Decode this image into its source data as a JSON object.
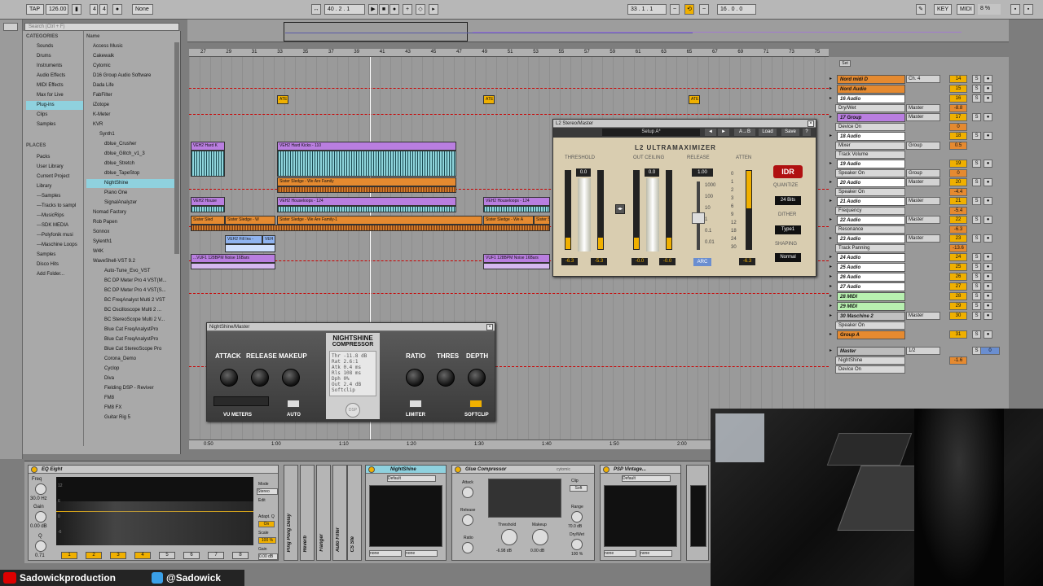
{
  "transport": {
    "tap": "TAP",
    "tempo": "126.00",
    "signature_num": "4",
    "signature_den": "4",
    "quant": "None",
    "position": "40 . 2 . 1",
    "loop_start": "33 . 1 . 1",
    "loop_len": "16 . 0 . 0",
    "key": "KEY",
    "midi": "MIDI",
    "cpu": "8 %"
  },
  "browser": {
    "categories_header": "CATEGORIES",
    "search_placeholder": "Search (Ctrl + F)",
    "categories": [
      "Sounds",
      "Drums",
      "Instruments",
      "Audio Effects",
      "MIDI Effects",
      "Max for Live",
      "Plug-ins",
      "Clips",
      "Samples"
    ],
    "places_header": "PLACES",
    "places": [
      "Packs",
      "User Library",
      "Current Project",
      "Library",
      "---Samples",
      "---Tracks to sampl",
      "---MusicRips",
      "---SDK MEDIA",
      "---Polyfonik musi",
      "---Maschine Loops",
      "Samples",
      "Disco Hits",
      "Add Folder..."
    ],
    "name_header": "Name",
    "items": [
      "Access Music",
      "Cakewalk",
      "Cytomic",
      "D16 Group Audio Software",
      "Dada Life",
      "FabFilter",
      "iZotope",
      "K-Meter",
      "KVR",
      "Synth1",
      "dblue_Crusher",
      "dblue_Glitch_v1_3",
      "dblue_Stretch",
      "dblue_TapeStop",
      "NightShine",
      "Piano One",
      "SignalAnalyzer",
      "Nomad Factory",
      "Rob Papen",
      "Sonnox",
      "Sylenth1",
      "W4K",
      "WaveShell-VST 9.2",
      "Auto-Tune_Evo_VST",
      "BC DP Meter Pro 4 VST(M...",
      "BC DP Meter Pro 4 VST(S...",
      "BC FreqAnalyst Multi 2 VST",
      "BC Oscilloscope Multi 2 ...",
      "BC StereoScope Multi 2 V...",
      "Blue Cat FreqAnalystPro",
      "Blue Cat FreqAnalystPro",
      "Blue Cat StereoScope Pro",
      "Corona_Demo",
      "Cyclop",
      "Diva",
      "Fielding DSP - Reviver",
      "FM8",
      "FM8 FX",
      "Guitar Rig 5"
    ]
  },
  "ruler": {
    "bars": [
      "27",
      "29",
      "31",
      "33",
      "35",
      "37",
      "39",
      "41",
      "43",
      "45",
      "47",
      "49",
      "51",
      "53",
      "55",
      "57",
      "59",
      "61",
      "63",
      "65",
      "67",
      "69",
      "71",
      "73",
      "75"
    ],
    "times": [
      "0:50",
      "1:00",
      "1:10",
      "1:20",
      "1:30",
      "1:40",
      "1:50",
      "2:00",
      "2:10"
    ]
  },
  "clips": {
    "ate": "ATE",
    "veh2_hard": "VEH2 Hard K",
    "veh2_hard_kicks": "VEH2 Hard Kicks - 110",
    "sister_a": "Sister Sledge - We Are Family",
    "veh2_house": "VEH2 House",
    "veh2_houseloops_a": "VEH2 Houseloops - 124",
    "veh2_houseloops_b": "VEH2 Houseloops - 124",
    "sister_slec": "Sister Sled",
    "sister_b": "Sister Sledge - W",
    "sister_c": "Sister Sledge - We Are Family-1",
    "sister_d": "Sister Sledge - We A",
    "sister_e": "Sister Sledge -",
    "veh2_fill": "VEH2 Fill Ins -",
    "veh2_fill_b": "VEH",
    "vuf1_a": "...VUF1 128BPM Noise 16Bars",
    "vuf1_b": "VUF1 128BPM Noise 16Bars"
  },
  "mixer": {
    "set": "Set",
    "tracks": [
      {
        "name": "Nord midi D",
        "color": "#e58a30",
        "route": "Ch. 4",
        "num": "14"
      },
      {
        "name": "Nord Audio",
        "color": "#e58a30",
        "route": "",
        "num": "15"
      },
      {
        "name": "16 Audio",
        "color": "#ffffff",
        "route": "",
        "num": "16",
        "sub": "Dry/Wet",
        "sub_route": "Master",
        "vol": "-8.8"
      },
      {
        "name": "17 Group",
        "color": "#b97ee0",
        "route": "Master",
        "num": "17",
        "sub": "Device On",
        "vol": "0"
      },
      {
        "name": "18 Audio",
        "color": "#ffffff",
        "route": "",
        "num": "18",
        "sub": "Mixer",
        "sub2": "Track Volume",
        "sub_route": "Group",
        "vol": "0.5"
      },
      {
        "name": "19 Audio",
        "color": "#ffffff",
        "route": "",
        "num": "19",
        "sub": "Speaker On",
        "sub_route": "Group",
        "vol": "0"
      },
      {
        "name": "20 Audio",
        "color": "#ffffff",
        "route": "Master",
        "num": "20",
        "sub": "Speaker On",
        "vol": "-4.4"
      },
      {
        "name": "21 Audio",
        "color": "#ffffff",
        "route": "Master",
        "num": "21",
        "sub": "Frequency",
        "vol": "-5.4"
      },
      {
        "name": "22 Audio",
        "color": "#ffffff",
        "route": "Master",
        "num": "22",
        "sub": "Resonance",
        "vol": "-6.3"
      },
      {
        "name": "23 Audio",
        "color": "#ffffff",
        "route": "Master",
        "num": "23",
        "sub": "Track Panning",
        "vol": "-13.6"
      },
      {
        "name": "24 Audio",
        "color": "#ffffff",
        "num": "24"
      },
      {
        "name": "25 Audio",
        "color": "#ffffff",
        "num": "25"
      },
      {
        "name": "26 Audio",
        "color": "#ffffff",
        "num": "26"
      },
      {
        "name": "27 Audio",
        "color": "#ffffff",
        "num": "27"
      },
      {
        "name": "28 MIDI",
        "color": "#b8f0b0",
        "num": "28"
      },
      {
        "name": "29 MIDI",
        "color": "#b8f0b0",
        "num": "29"
      },
      {
        "name": "30 Maschine 2",
        "color": "#c0c0c0",
        "route": "Master",
        "num": "30",
        "sub": "Speaker On"
      },
      {
        "name": "Group A",
        "color": "#e58a30",
        "num": "31"
      },
      {
        "name": "Master",
        "color": "#bdbdbd",
        "route": "1/2",
        "sub": "NightShine",
        "sub2": "Device On",
        "vol": "-1.6",
        "vol2": "0"
      }
    ]
  },
  "l2": {
    "title": "L2 Stereo/Master",
    "setup": "Setup A*",
    "ab": "A→B",
    "load": "Load",
    "save": "Save",
    "help": "?",
    "brand": "L2 ULTRAMAXIMIZER",
    "threshold": "THRESHOLD",
    "out_ceiling": "OUT CEILING",
    "release": "RELEASE",
    "atten": "ATTEN",
    "thr_val": "0.0",
    "ceil_val": "0.0",
    "rel_val": "1.00",
    "quantize": "QUANTIZE",
    "bits": "24 Bits",
    "dither": "DITHER",
    "dither_type": "Type1",
    "shaping": "SHAPING",
    "shaping_type": "Normal",
    "arc": "ARC",
    "idr": "IDR",
    "meter1": "-6.3",
    "meter2": "-5.3",
    "meter3": "-0.0",
    "meter4": "-0.0",
    "atten_val": "-6.3",
    "rel_scale": [
      "1000",
      "100",
      "10",
      "1",
      "0.1",
      "0.01"
    ],
    "atten_scale": [
      "0",
      "1",
      "2",
      "3",
      "6",
      "9",
      "12",
      "18",
      "24",
      "30"
    ]
  },
  "nightshine": {
    "title": "NightShine/Master",
    "name1": "NIGHTSHINE",
    "name2": "COMPRESSOR",
    "attack": "ATTACK",
    "release": "RELEASE",
    "makeup": "MAKEUP",
    "ratio": "RATIO",
    "thres": "THRES",
    "depth": "DEPTH",
    "vu": "VU METERS",
    "auto": "AUTO",
    "limiter": "LIMITER",
    "softclip": "SOFTCLIP",
    "dsp": "DSP",
    "readout": [
      "Thr -11.8 dB",
      "Rat 2.6:1",
      "Atk 0.4 ms",
      "Rls 108 ms",
      "Dph 0%",
      "Out 2.4 dB",
      "Softclip"
    ]
  },
  "devices": {
    "eq_title": "EQ Eight",
    "eq_freq": "Freq",
    "eq_freq_val": "30.0 Hz",
    "eq_gain": "Gain",
    "eq_gain_val": "0.00 dB",
    "eq_q": "Q",
    "eq_q_val": "0.71",
    "eq_mode": "Mode",
    "eq_mode_val": "Stereo",
    "eq_edit": "Edit",
    "eq_adapt": "Adapt. Q",
    "eq_on": "On",
    "eq_scale": "Scale",
    "eq_scale_val": "100 %",
    "eq_gain2": "Gain",
    "eq_gain2_val": "0.00 dB",
    "eq_bands": [
      "1",
      "2",
      "3",
      "4",
      "5",
      "6",
      "7",
      "8"
    ],
    "eq_db": [
      "12",
      "6",
      "0",
      "-6",
      "-12"
    ],
    "ping_pong": "Ping Pong Delay",
    "reverb": "Reverb",
    "flanger": "Flanger",
    "auto_filter": "Auto Filter",
    "cs_ste": "CS Ste",
    "nightshine_title": "NightShine",
    "preset_default": "Default",
    "none": "none",
    "glue_title": "Glue Compressor",
    "glue_brand": "cytomic",
    "attack": "Attack",
    "release": "Release",
    "ratio": "Ratio",
    "threshold": "Threshold",
    "threshold_val": "-6.98 dB",
    "makeup": "Makeup",
    "makeup_val": "0.00 dB",
    "range": "Range",
    "range_val": "70.0 dB",
    "drywet": "Dry/Wet",
    "drywet_val": "100 %",
    "clip": "Clip",
    "soft": "Soft",
    "psp_title": "PSP Vintage...",
    "psp_preset": "Default"
  },
  "social": {
    "youtube": "Sadowickproduction",
    "twitter": "@Sadowick"
  }
}
